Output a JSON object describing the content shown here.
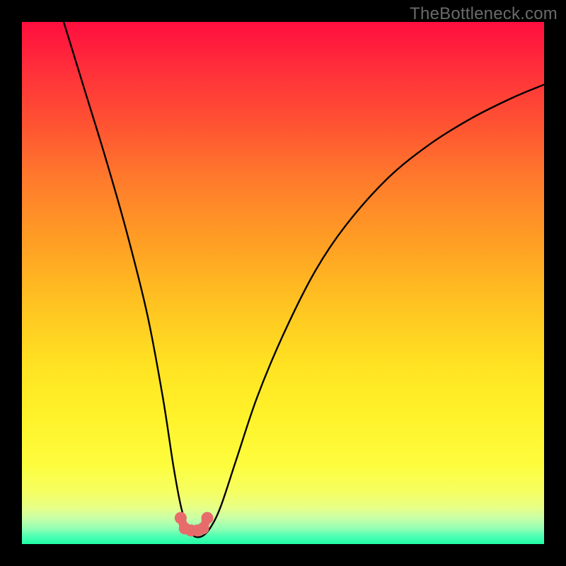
{
  "watermark": {
    "text": "TheBottleneck.com"
  },
  "colors": {
    "frame_bg": "#000000",
    "curve_stroke": "#000000",
    "marker_fill": "#e76b6b",
    "marker_stroke": "#d85a5a"
  },
  "chart_data": {
    "type": "line",
    "title": "",
    "xlabel": "",
    "ylabel": "",
    "xlim": [
      0,
      100
    ],
    "ylim": [
      0,
      100
    ],
    "grid": false,
    "legend": false,
    "series": [
      {
        "name": "bottleneck-curve",
        "x": [
          8,
          12,
          16,
          20,
          24,
          27,
          29,
          30.5,
          31.8,
          33,
          34.5,
          36,
          38,
          41,
          45,
          50,
          56,
          62,
          70,
          78,
          86,
          94,
          100
        ],
        "y": [
          100,
          87,
          74,
          60,
          44,
          28,
          15,
          7,
          3,
          1.5,
          1.5,
          3,
          7,
          16,
          28,
          40,
          52,
          61,
          70,
          76.5,
          81.5,
          85.5,
          88
        ]
      }
    ],
    "markers": {
      "name": "valley-points",
      "x": [
        30.4,
        31.2,
        32.4,
        33.6,
        34.7,
        35.5
      ],
      "y": [
        5.0,
        3.0,
        2.6,
        2.6,
        3.0,
        5.0
      ]
    }
  }
}
